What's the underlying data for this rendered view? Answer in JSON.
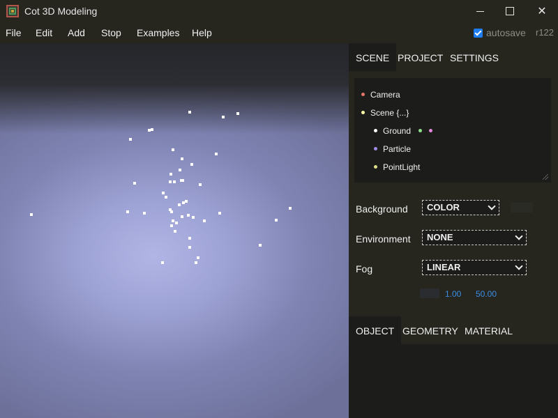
{
  "window": {
    "title": "Cot 3D Modeling",
    "controls": {
      "minimize": "",
      "maximize": "",
      "close": "✕"
    }
  },
  "menu": {
    "items": [
      "File",
      "Edit",
      "Add",
      "Stop",
      "Examples",
      "Help"
    ],
    "autosave_label": "autosave",
    "autosave_checked": true,
    "revision": "r122"
  },
  "viewport": {
    "particle_count": 45
  },
  "sidebar": {
    "top_tabs": [
      "SCENE",
      "PROJECT",
      "SETTINGS"
    ],
    "active_top_tab": "SCENE",
    "outliner": [
      {
        "label": "Camera",
        "dot_color": "#e0766d",
        "extra_dots": []
      },
      {
        "label": "Scene {...}",
        "dot_color": "#ffffa8",
        "extra_dots": []
      },
      {
        "label": "Ground",
        "dot_color": "#ffffff",
        "extra_dots": [
          "#8ee08a",
          "#e58ae0"
        ]
      },
      {
        "label": "Particle",
        "dot_color": "#a08ce8",
        "extra_dots": []
      },
      {
        "label": "PointLight",
        "dot_color": "#dede8a",
        "extra_dots": []
      }
    ],
    "background": {
      "label": "Background",
      "value": "COLOR"
    },
    "environment": {
      "label": "Environment",
      "value": "NONE"
    },
    "fog": {
      "label": "Fog",
      "value": "LINEAR",
      "near": "1.00",
      "far": "50.00"
    },
    "bottom_tabs": [
      "OBJECT",
      "GEOMETRY",
      "MATERIAL"
    ],
    "active_bottom_tab": "OBJECT"
  }
}
